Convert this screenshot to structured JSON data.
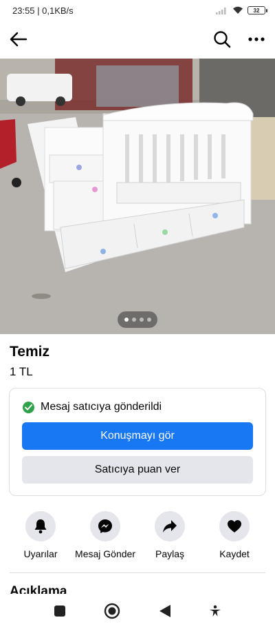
{
  "status_bar": {
    "time_speed": "23:55 | 0,1KB/s",
    "battery": "32"
  },
  "app_bar": {
    "back_icon": "arrow-left-icon",
    "search_icon": "search-icon",
    "more_icon": "more-horizontal-icon"
  },
  "listing": {
    "pager_dots": 4,
    "pager_active": 1,
    "title": "Temiz",
    "price": "1 TL"
  },
  "message_card": {
    "status_text": "Mesaj satıcıya gönderildi",
    "primary_button": "Konuşmayı gör",
    "secondary_button": "Satıcıya puan ver",
    "status_color": "#31a24c",
    "primary_color": "#1877f2"
  },
  "actions": [
    {
      "label": "Uyarılar",
      "icon": "bell-icon"
    },
    {
      "label": "Mesaj Gönder",
      "icon": "messenger-icon"
    },
    {
      "label": "Paylaş",
      "icon": "share-icon"
    },
    {
      "label": "Kaydet",
      "icon": "heart-icon"
    }
  ],
  "description": {
    "title": "Açıklama"
  },
  "nav_bar": {
    "items": [
      "square-icon",
      "home-circle-icon",
      "back-triangle-icon",
      "accessibility-icon"
    ]
  }
}
